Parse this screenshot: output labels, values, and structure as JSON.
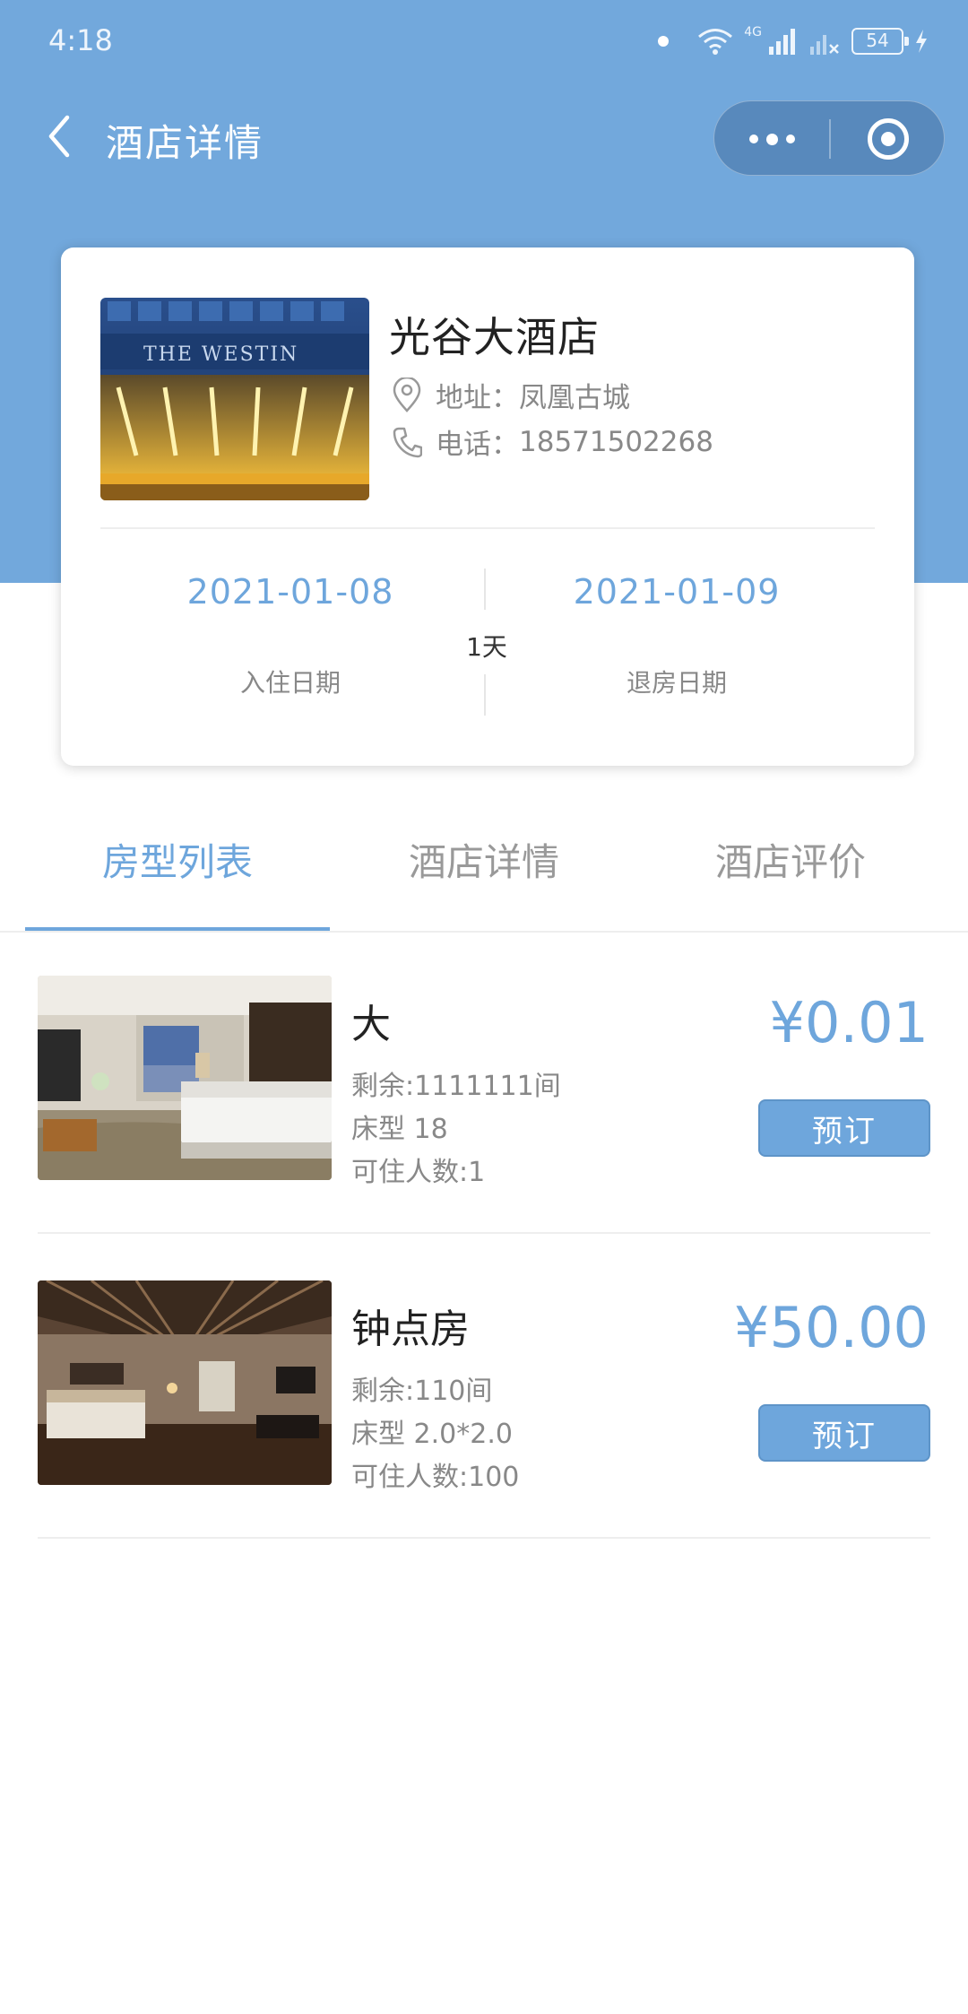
{
  "status_bar": {
    "time": "4:18",
    "network": "4G",
    "battery": "54"
  },
  "nav": {
    "title": "酒店详情"
  },
  "hotel": {
    "name": "光谷大酒店",
    "photo_sign": "THE WESTIN",
    "address_label": "地址：",
    "address": "凤凰古城",
    "phone_label": "电话：",
    "phone": "18571502268"
  },
  "stay": {
    "checkin_date": "2021-01-08",
    "checkout_date": "2021-01-09",
    "nights": "1天",
    "checkin_label": "入住日期",
    "checkout_label": "退房日期"
  },
  "tabs": [
    {
      "label": "房型列表",
      "active": true
    },
    {
      "label": "酒店详情",
      "active": false
    },
    {
      "label": "酒店评价",
      "active": false
    }
  ],
  "rooms": [
    {
      "name": "大",
      "remaining": "剩余:1111111间",
      "bed": "床型 18",
      "capacity": "可住人数:1",
      "price": "¥0.01",
      "book_label": "预订"
    },
    {
      "name": "钟点房",
      "remaining": "剩余:110间",
      "bed": "床型 2.0*2.0",
      "capacity": "可住人数:100",
      "price": "¥50.00",
      "book_label": "预订"
    }
  ],
  "colors": {
    "header_blue": "#72a8dc",
    "accent": "#6ea6dc"
  }
}
